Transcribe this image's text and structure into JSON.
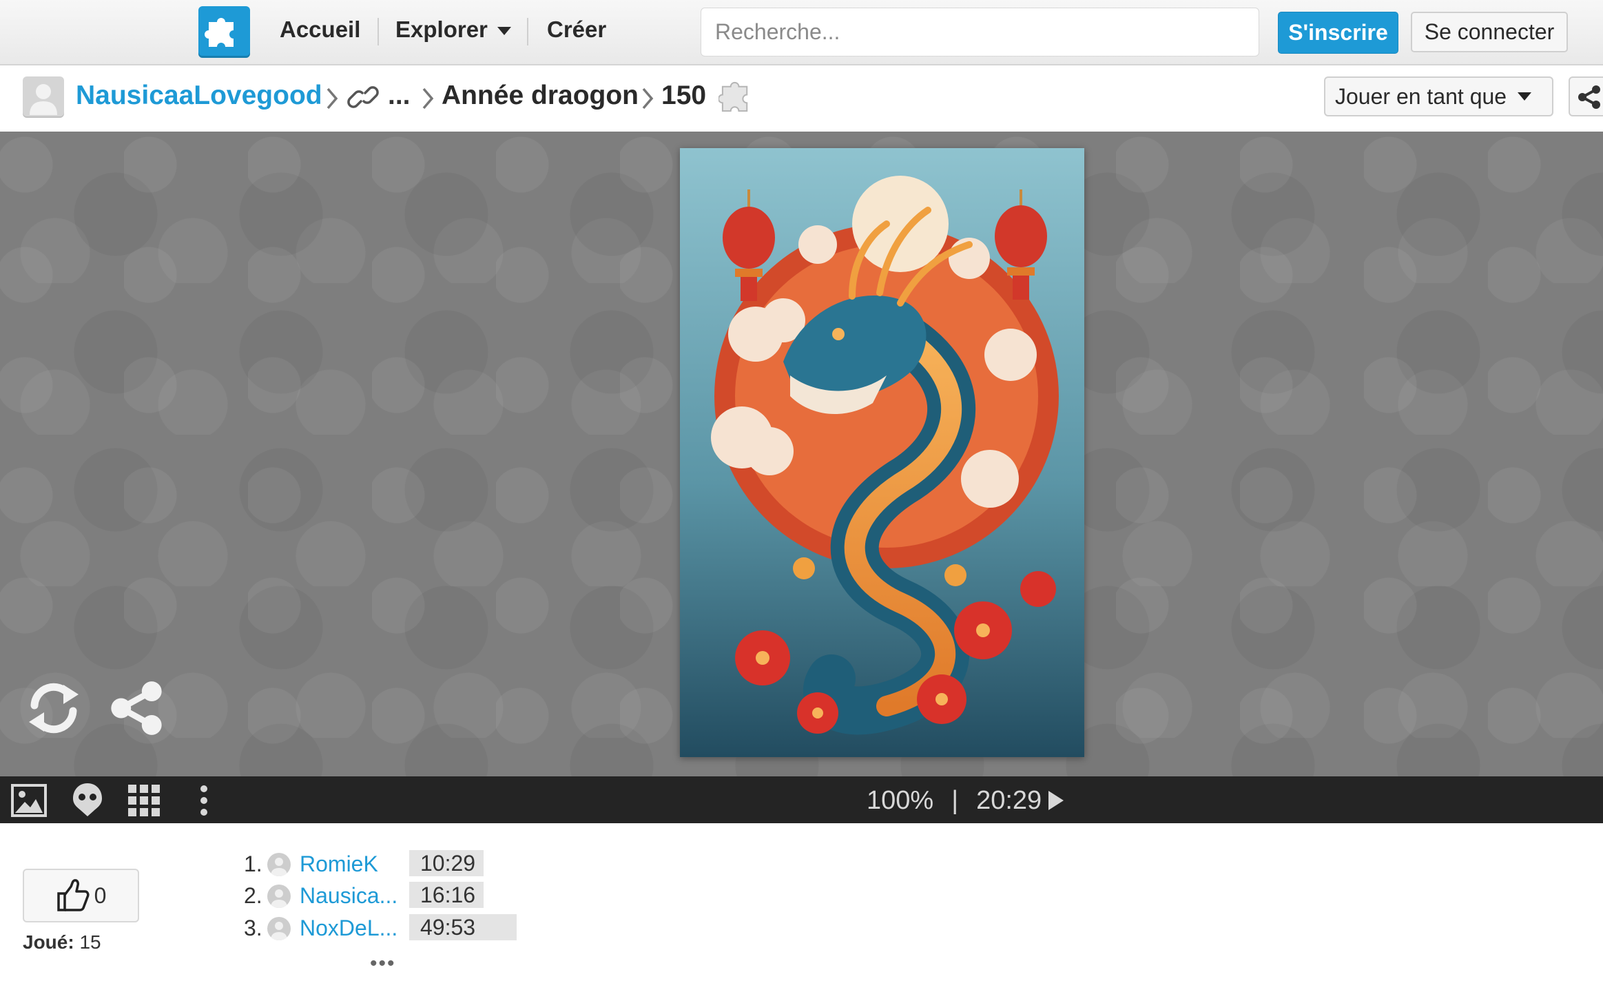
{
  "nav": {
    "home": "Accueil",
    "explore": "Explorer",
    "create": "Créer",
    "search_placeholder": "Recherche...",
    "signup": "S'inscrire",
    "login": "Se connecter"
  },
  "breadcrumb": {
    "user": "NausicaaLovegood",
    "ellipsis": "...",
    "collection": "Année draogon",
    "pieces": "150"
  },
  "play_as": "Jouer en tant que",
  "toolbar": {
    "completion": "100%",
    "separator": "|",
    "time": "20:29"
  },
  "likes": {
    "count": "0"
  },
  "played": {
    "label": "Joué:",
    "count": "15"
  },
  "leaderboard": [
    {
      "rank": "1.",
      "name": "RomieK",
      "time": "10:29"
    },
    {
      "rank": "2.",
      "name": "Nausica...",
      "time": "16:16"
    },
    {
      "rank": "3.",
      "name": "NoxDeL...",
      "time": "49:53"
    }
  ],
  "leaderboard_more": "•••",
  "colors": {
    "accent": "#1e9ad6",
    "toolbar_bg": "#242424",
    "stage_bg": "#7e7e7e"
  },
  "icons": [
    "puzzle-logo-icon",
    "link-icon",
    "puzzle-piece-icon",
    "share-icon",
    "refresh-icon",
    "image-icon",
    "ghost-icon",
    "grid-icon",
    "more-vertical-icon",
    "thumbs-up-icon",
    "user-avatar-icon"
  ]
}
